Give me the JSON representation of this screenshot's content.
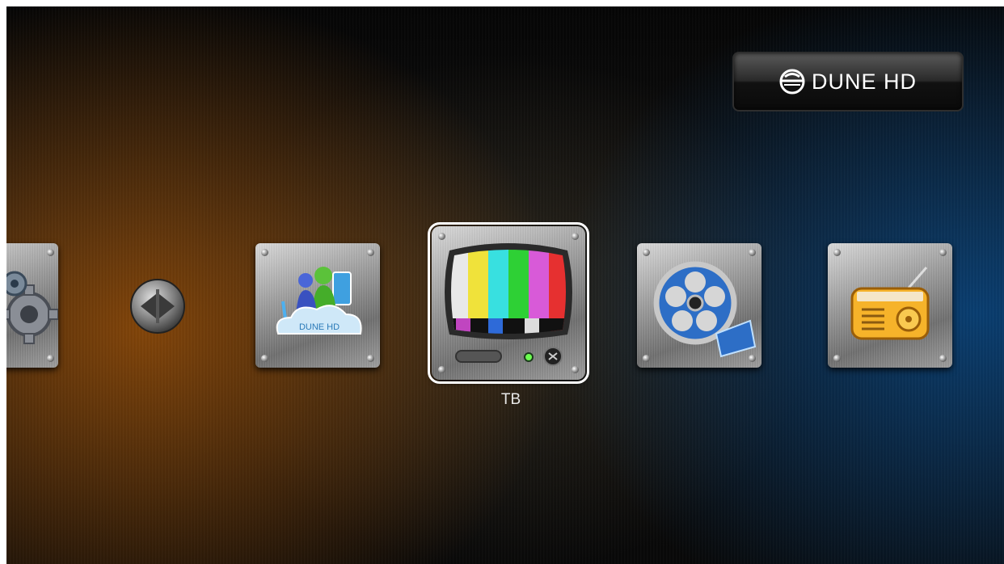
{
  "header": {
    "logo_text": "DUNE HD",
    "logo_icon": "dune-hd-globe-icon"
  },
  "carousel": {
    "selected_label": "ТВ",
    "items": [
      {
        "icon": "settings-gears-icon"
      },
      {
        "icon": "left-right-arrows-icon"
      },
      {
        "icon": "dune-hd-cloud-icon",
        "cloud_text": "DUNE HD"
      },
      {
        "icon": "tv-test-pattern-icon"
      },
      {
        "icon": "film-reel-icon"
      },
      {
        "icon": "radio-icon"
      }
    ]
  },
  "colors": {
    "selection_border": "#ffffff",
    "warm_glow": "#964e08",
    "cool_glow": "#08468a"
  }
}
